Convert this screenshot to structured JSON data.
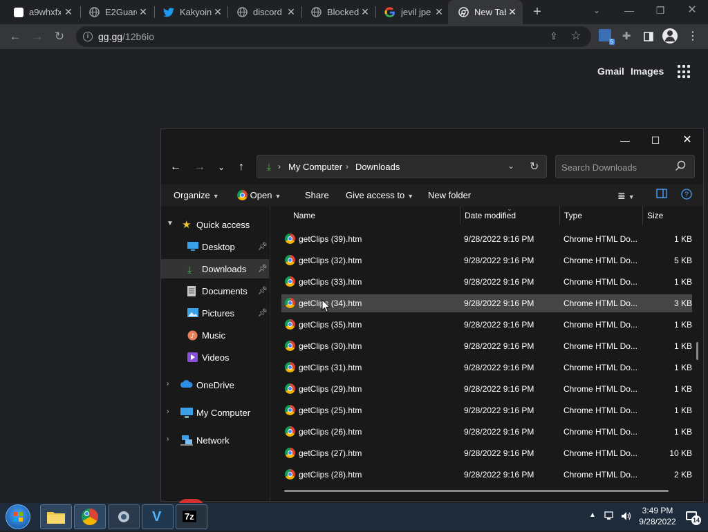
{
  "browser": {
    "tabs": [
      {
        "title": "a9whxfx",
        "favicon": "chrome-page-icon",
        "color": "#ffffff"
      },
      {
        "title": "E2Guard",
        "favicon": "globe-icon",
        "color": "#9aa0a6"
      },
      {
        "title": "Kakyoin",
        "favicon": "twitter-icon",
        "color": "#1d9bf0"
      },
      {
        "title": "discord",
        "favicon": "globe-icon",
        "color": "#9aa0a6"
      },
      {
        "title": "Blocked",
        "favicon": "globe-icon",
        "color": "#9aa0a6"
      },
      {
        "title": "jevil jpe",
        "favicon": "google-icon",
        "color": "#4285f4"
      },
      {
        "title": "New Tab",
        "favicon": "chrome-icon",
        "color": "#e8eaed"
      }
    ],
    "url_host": "gg.gg",
    "url_path": "/12b6io",
    "extension_badge": "5",
    "ntp_links": {
      "gmail": "Gmail",
      "images": "Images"
    }
  },
  "explorer": {
    "breadcrumb": [
      "My Computer",
      "Downloads"
    ],
    "search_placeholder": "Search Downloads",
    "commands": {
      "organize": "Organize",
      "open": "Open",
      "share": "Share",
      "give_access": "Give access to",
      "new_folder": "New folder"
    },
    "nav": {
      "quick_access": "Quick access",
      "desktop": "Desktop",
      "downloads": "Downloads",
      "documents": "Documents",
      "pictures": "Pictures",
      "music": "Music",
      "videos": "Videos",
      "onedrive": "OneDrive",
      "my_computer": "My Computer",
      "network": "Network"
    },
    "columns": {
      "name": "Name",
      "date": "Date modified",
      "type": "Type",
      "size": "Size"
    },
    "files": [
      {
        "name": "getClips (39).htm",
        "date": "9/28/2022 9:16 PM",
        "type": "Chrome HTML Do...",
        "size": "1 KB"
      },
      {
        "name": "getClips (32).htm",
        "date": "9/28/2022 9:16 PM",
        "type": "Chrome HTML Do...",
        "size": "5 KB"
      },
      {
        "name": "getClips (33).htm",
        "date": "9/28/2022 9:16 PM",
        "type": "Chrome HTML Do...",
        "size": "1 KB"
      },
      {
        "name": "getClips (34).htm",
        "date": "9/28/2022 9:16 PM",
        "type": "Chrome HTML Do...",
        "size": "3 KB"
      },
      {
        "name": "getClips (35).htm",
        "date": "9/28/2022 9:16 PM",
        "type": "Chrome HTML Do...",
        "size": "1 KB"
      },
      {
        "name": "getClips (30).htm",
        "date": "9/28/2022 9:16 PM",
        "type": "Chrome HTML Do...",
        "size": "1 KB"
      },
      {
        "name": "getClips (31).htm",
        "date": "9/28/2022 9:16 PM",
        "type": "Chrome HTML Do...",
        "size": "1 KB"
      },
      {
        "name": "getClips (29).htm",
        "date": "9/28/2022 9:16 PM",
        "type": "Chrome HTML Do...",
        "size": "1 KB"
      },
      {
        "name": "getClips (25).htm",
        "date": "9/28/2022 9:16 PM",
        "type": "Chrome HTML Do...",
        "size": "1 KB"
      },
      {
        "name": "getClips (26).htm",
        "date": "9/28/2022 9:16 PM",
        "type": "Chrome HTML Do...",
        "size": "1 KB"
      },
      {
        "name": "getClips (27).htm",
        "date": "9/28/2022 9:16 PM",
        "type": "Chrome HTML Do...",
        "size": "10 KB"
      },
      {
        "name": "getClips (28).htm",
        "date": "9/28/2022 9:16 PM",
        "type": "Chrome HTML Do...",
        "size": "2 KB"
      }
    ],
    "hovered_row": 3
  },
  "taskbar": {
    "time": "3:49 PM",
    "date": "9/28/2022",
    "notification_count": "14"
  }
}
